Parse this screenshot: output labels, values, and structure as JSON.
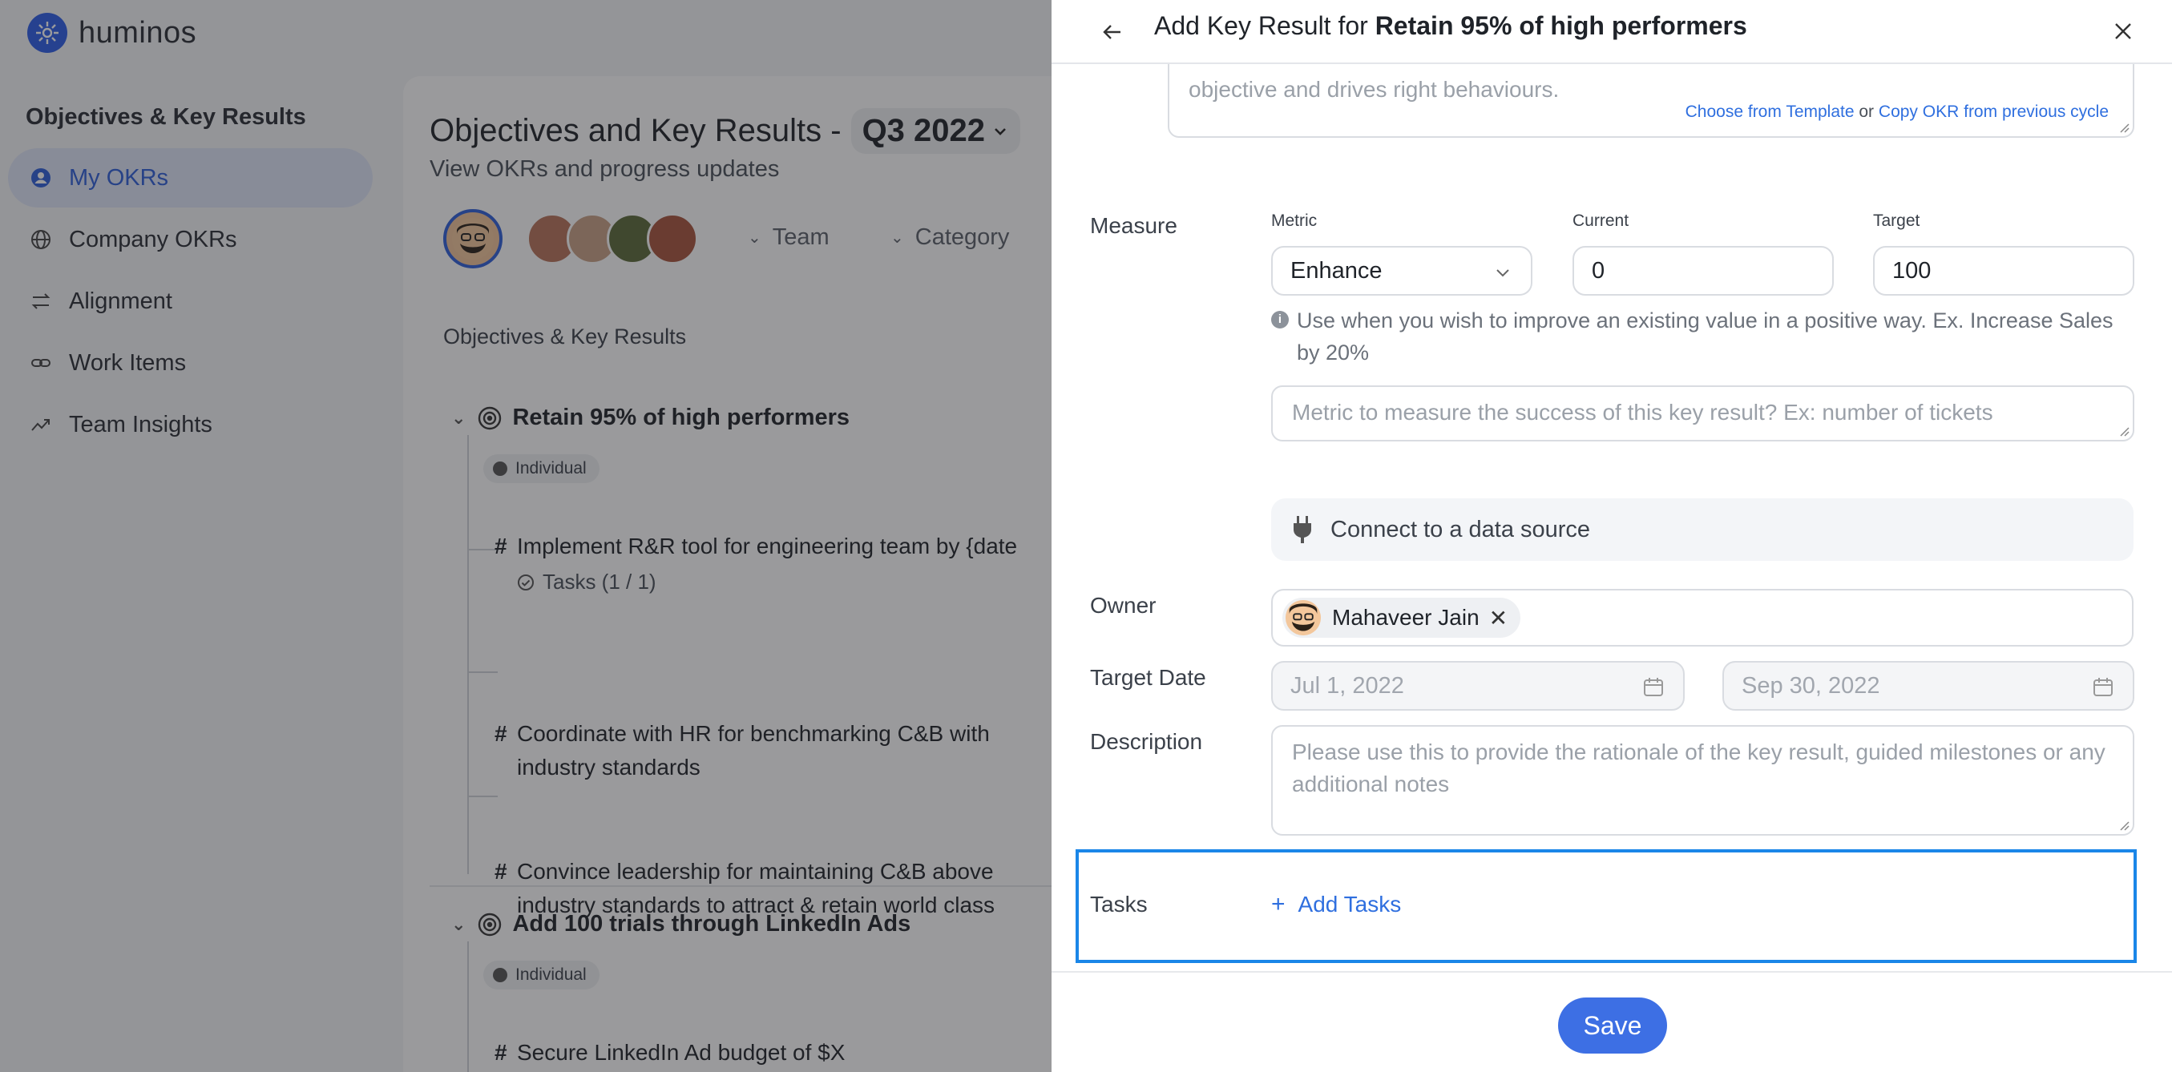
{
  "app": {
    "brand": "huminos",
    "nav_heading": "Objectives & Key Results",
    "nav": [
      {
        "label": "My OKRs",
        "icon": "user-circle-icon",
        "active": true
      },
      {
        "label": "Company OKRs",
        "icon": "globe-icon"
      },
      {
        "label": "Alignment",
        "icon": "swap-arrows-icon"
      },
      {
        "label": "Work Items",
        "icon": "link-icon"
      },
      {
        "label": "Team Insights",
        "icon": "trend-icon"
      }
    ]
  },
  "main": {
    "title": "Objectives and Key Results -",
    "quarter": "Q3 2022",
    "subtitle": "View OKRs and progress updates",
    "filters": {
      "team": "Team",
      "category": "Category"
    },
    "section_label": "Objectives & Key Results",
    "objectives": [
      {
        "title": "Retain 95% of high performers",
        "badge": "Individual",
        "key_results": [
          {
            "title": "Implement R&R tool for engineering team by {date",
            "meta": "Tasks (1 / 1)"
          },
          {
            "title_line1": "Coordinate with HR for benchmarking C&B with",
            "title_line2": "industry standards"
          },
          {
            "title_line1": "Convince leadership for maintaining C&B above",
            "title_line2": "industry standards to attract & retain world class"
          }
        ]
      },
      {
        "title": "Add 100 trials through LinkedIn Ads",
        "badge": "Individual",
        "key_results": [
          {
            "title": "Secure LinkedIn Ad budget of $X"
          }
        ]
      }
    ]
  },
  "drawer": {
    "title_prefix": "Add Key Result for",
    "title_bold": "Retain 95% of high performers",
    "top_textarea_text": "objective and drives right behaviours.",
    "template_link": "Choose from Template",
    "or_text": "or",
    "copy_link": "Copy OKR from previous cycle",
    "measure": {
      "label": "Measure",
      "metric_label": "Metric",
      "metric_value": "Enhance",
      "current_label": "Current",
      "current_value": "0",
      "target_label": "Target",
      "target_value": "100",
      "hint": "Use when you wish to improve an existing value in a positive way. Ex. Increase Sales by 20%",
      "metric_placeholder": "Metric to measure the success of this key result? Ex: number of tickets"
    },
    "datasource": "Connect to a data source",
    "owner": {
      "label": "Owner",
      "name": "Mahaveer Jain"
    },
    "target_date": {
      "label": "Target Date",
      "start": "Jul 1, 2022",
      "end": "Sep 30, 2022"
    },
    "description": {
      "label": "Description",
      "placeholder": "Please use this to provide the rationale of the key result, guided milestones or any additional notes"
    },
    "tasks": {
      "label": "Tasks",
      "add": "Add Tasks"
    },
    "save": "Save"
  },
  "colors": {
    "accent": "#3d6fe4",
    "highlight": "#1a86e8",
    "overlay": "rgba(30,32,36,0.45)"
  }
}
